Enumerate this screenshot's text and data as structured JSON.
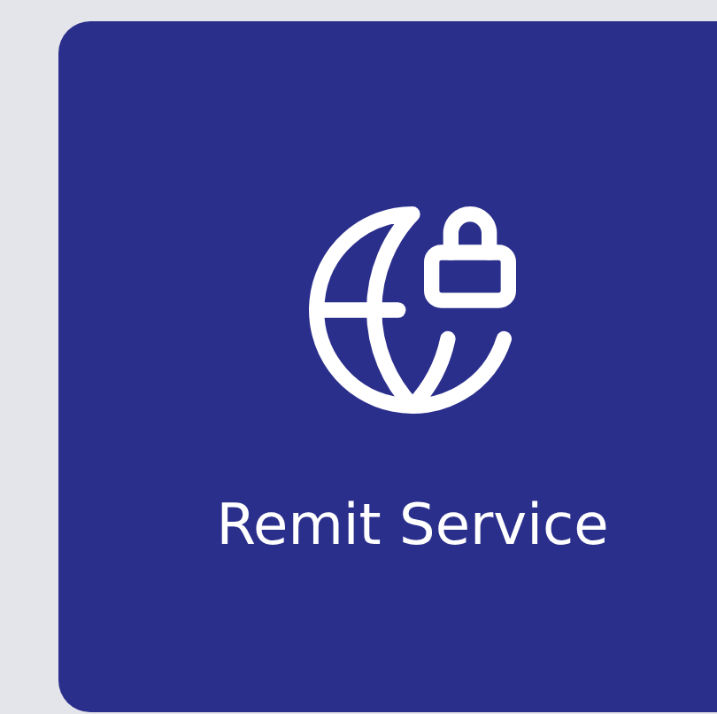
{
  "card": {
    "title": "Remit Service"
  }
}
